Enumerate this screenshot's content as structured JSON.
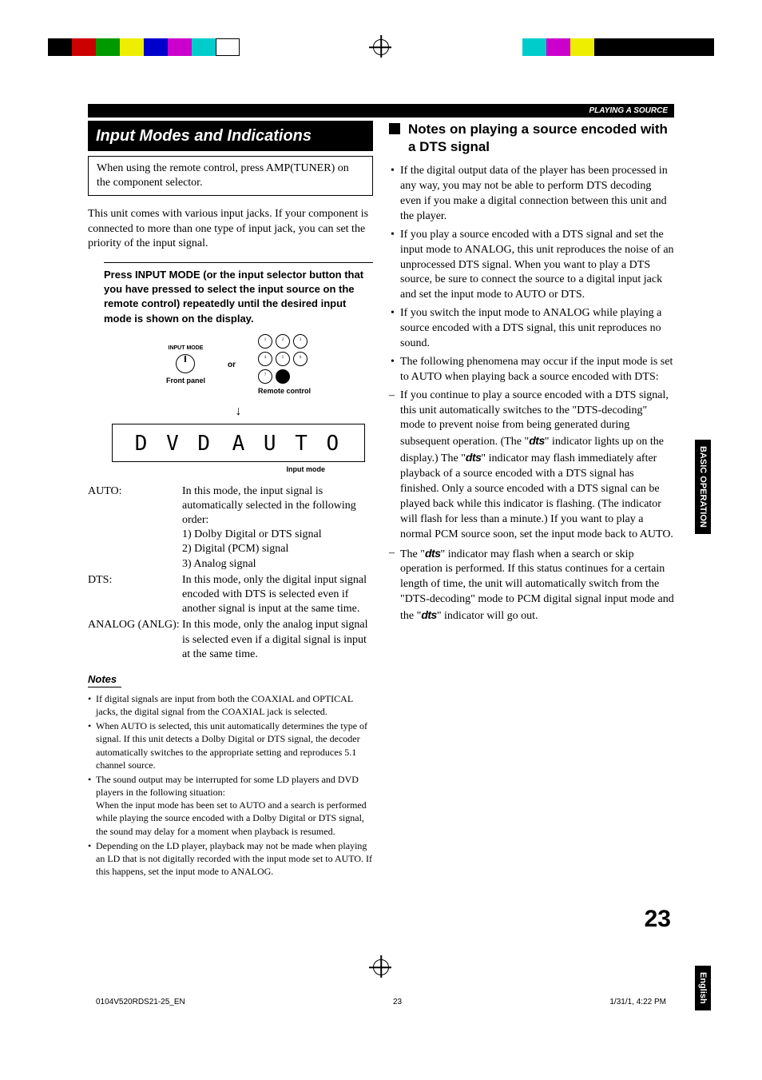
{
  "header": {
    "breadcrumb": "PLAYING A SOURCE"
  },
  "left": {
    "sectionTitle": "Input Modes and Indications",
    "remoteNote": "When using the remote control, press AMP(TUNER) on the component selector.",
    "intro": "This unit comes with various input jacks. If your component is connected to more than one type of input jack, you can set the priority of the input signal.",
    "instruction": "Press INPUT MODE (or the input selector button that you have pressed to select the input source on the remote control) repeatedly until the desired input mode is shown on the display.",
    "diagram": {
      "inputModeLabel": "INPUT MODE",
      "frontPanel": "Front panel",
      "or": "or",
      "remoteControl": "Remote control",
      "remoteTop": [
        "CD",
        "TUNER",
        "MD/CD-R"
      ],
      "remoteMid": [
        "DVD",
        "D-TV/CBL",
        "VCR"
      ],
      "remoteBot": [
        "V-AUX",
        "6CH IN.",
        ""
      ]
    },
    "display": {
      "source": "D V D",
      "mode": "A U T O",
      "label": "Input mode"
    },
    "modes": {
      "auto": {
        "label": "AUTO:",
        "desc": "In this mode, the input signal is automatically selected in the following order:",
        "l1": "1) Dolby Digital or DTS signal",
        "l2": "2) Digital (PCM) signal",
        "l3": "3) Analog signal"
      },
      "dts": {
        "label": "DTS:",
        "desc": "In this mode, only the digital input signal encoded with DTS is selected even if another signal is input at the same time."
      },
      "analog": {
        "label": "ANALOG (ANLG):",
        "desc": "In this mode, only the analog input signal is selected even if a digital signal is input at the same time."
      }
    },
    "notesLabel": "Notes",
    "notes": {
      "n1": "If digital signals are input from both the COAXIAL and OPTICAL jacks, the digital signal from the COAXIAL jack is selected.",
      "n2": "When AUTO is selected, this unit automatically determines the type of signal. If this unit detects a Dolby Digital or DTS signal, the decoder automatically switches to the appropriate setting and reproduces 5.1 channel source.",
      "n3": "The sound output may be interrupted for some LD players and DVD players in the following situation:",
      "n3b": "When the input mode has been set to AUTO and a search is performed while playing the source encoded with a Dolby Digital or DTS signal, the sound may delay for a moment when playback is resumed.",
      "n4": "Depending on the LD player, playback may not be made when playing an LD that is not digitally recorded with the input mode set to AUTO. If this happens, set the input mode to ANALOG."
    }
  },
  "right": {
    "heading": "Notes on playing a source encoded with a DTS signal",
    "b1": "If the digital output data of the player has been processed in any way, you may not be able to perform DTS decoding even if you make a digital connection between this unit and the player.",
    "b2": "If you play a source encoded with a DTS signal and set the input mode to ANALOG, this unit reproduces the noise of an unprocessed DTS signal. When you want to play a DTS source, be sure to connect the source to a digital input jack and set the input mode to AUTO or DTS.",
    "b3": "If you switch the input mode to ANALOG while playing a source encoded with a DTS signal, this unit reproduces no sound.",
    "b4": "The following phenomena may occur if the input mode is set to AUTO when playing back a source encoded with DTS:",
    "d1a": "If you continue to play a source encoded with a DTS signal, this unit automatically switches to the \"DTS-decoding\" mode to prevent noise from being generated during subsequent operation. (The \"",
    "d1b": "\" indicator lights up on the display.) The \"",
    "d1c": "\" indicator may flash immediately after playback of a source encoded with a DTS signal has finished. Only a source encoded with a DTS signal can be played back while this indicator is flashing. (The indicator will flash for less than a minute.) If you want to play a normal PCM source soon, set the input mode back to AUTO.",
    "d2a": "The \"",
    "d2b": "\" indicator may flash when a search or skip operation is performed. If this status continues for a certain length of time, the unit will automatically switch from the \"DTS-decoding\" mode to PCM digital signal input mode and the \"",
    "d2c": "\" indicator will go out.",
    "dts": "dts"
  },
  "sideTabs": {
    "t1": "BASIC OPERATION",
    "t2": "English"
  },
  "pageNumber": "23",
  "footer": {
    "file": "0104V520RDS21-25_EN",
    "page": "23",
    "date": "1/31/1, 4:22 PM"
  }
}
